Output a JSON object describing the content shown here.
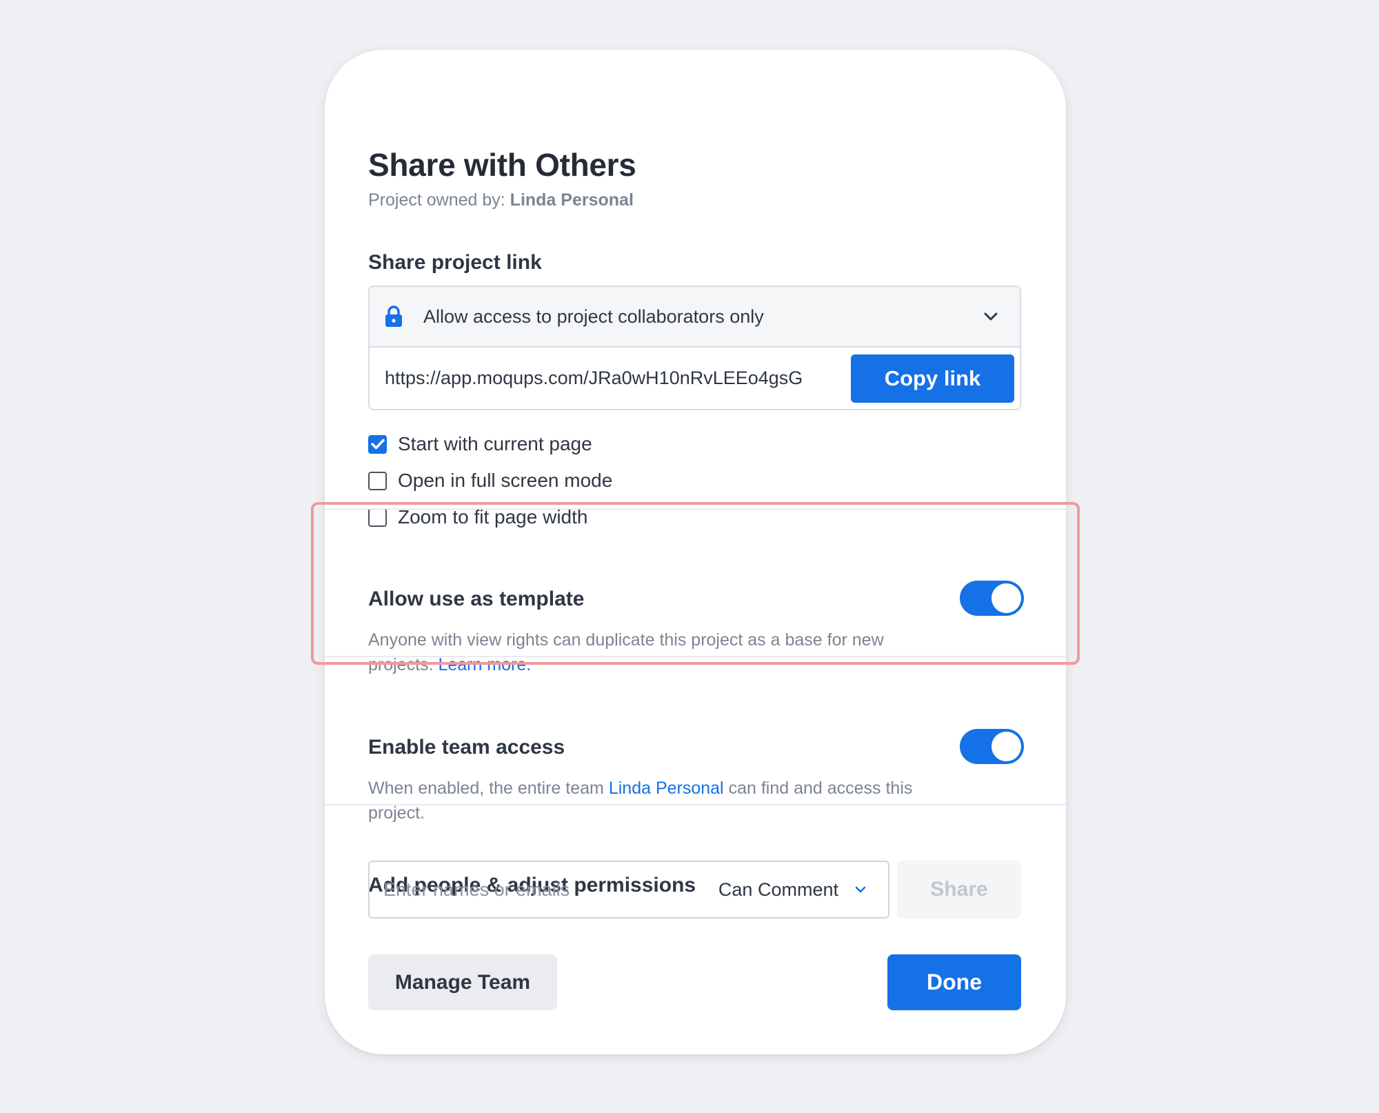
{
  "dialog": {
    "title": "Share with Others",
    "owner_prefix": "Project owned by: ",
    "owner_name": "Linda Personal"
  },
  "share_link": {
    "label": "Share project link",
    "access_option": "Allow access to project collaborators only",
    "url": "https://app.moqups.com/JRa0wH10nRvLEEo4gsG",
    "copy_label": "Copy link"
  },
  "options": [
    {
      "label": "Start with current page",
      "checked": true
    },
    {
      "label": "Open in full screen mode",
      "checked": false
    },
    {
      "label": "Zoom to fit page width",
      "checked": false
    }
  ],
  "template_setting": {
    "title": "Allow use as template",
    "description": "Anyone with view rights can duplicate this project as a base for new projects.",
    "link_text": "Learn more.",
    "enabled": true
  },
  "team_setting": {
    "title": "Enable team access",
    "description_before": "When enabled, the entire team ",
    "team_name": "Linda Personal",
    "description_after": " can find and access this project.",
    "enabled": true
  },
  "people": {
    "label": "Add people & adjust permissions",
    "input_placeholder": "Enter names or emails",
    "permission": "Can Comment",
    "share_label": "Share"
  },
  "footer": {
    "manage_label": "Manage Team",
    "done_label": "Done"
  },
  "colors": {
    "accent": "#1471e6",
    "highlight_border": "#f09a9d",
    "background": "#eef0f4"
  }
}
